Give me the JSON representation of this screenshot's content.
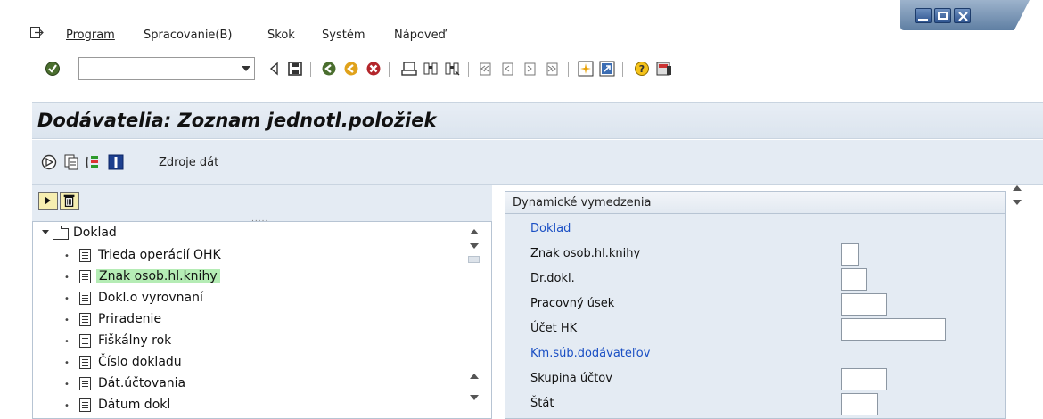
{
  "menu": {
    "items": [
      {
        "label": "Program"
      },
      {
        "label": "Spracovanie(B)"
      },
      {
        "label": "Skok"
      },
      {
        "label": "Systém"
      },
      {
        "label": "Nápoveď"
      }
    ]
  },
  "toolbar": {
    "command_value": "",
    "icons": [
      "enter-check-icon",
      "back-arrow-icon",
      "save-icon",
      "back-icon",
      "exit-icon",
      "cancel-icon",
      "print-icon",
      "find-icon",
      "find-next-icon",
      "first-page-icon",
      "prev-page-icon",
      "next-page-icon",
      "last-page-icon",
      "new-session-icon",
      "shortcut-icon",
      "help-icon",
      "layout-icon"
    ]
  },
  "title": "Dodávatelia: Zoznam jednotl.položiek",
  "app_toolbar": {
    "source_label": "Zdroje dát"
  },
  "tree": {
    "root": "Doklad",
    "items": [
      {
        "label": "Trieda operácií OHK",
        "selected": false
      },
      {
        "label": "Znak osob.hl.knihy",
        "selected": true
      },
      {
        "label": "Dokl.o vyrovnaní",
        "selected": false
      },
      {
        "label": "Priradenie",
        "selected": false
      },
      {
        "label": "Fiškálny rok",
        "selected": false
      },
      {
        "label": "Číslo dokladu",
        "selected": false
      },
      {
        "label": "Dát.účtovania",
        "selected": false
      },
      {
        "label": "Dátum dokl",
        "selected": false
      }
    ]
  },
  "selections": {
    "header": "Dynamické vymedzenia",
    "rows": [
      {
        "label": "Doklad",
        "group": true
      },
      {
        "label": "Znak osob.hl.knihy",
        "group": false,
        "value": ""
      },
      {
        "label": "Dr.dokl.",
        "group": false,
        "value": ""
      },
      {
        "label": "Pracovný úsek",
        "group": false,
        "value": ""
      },
      {
        "label": "Účet HK",
        "group": false,
        "value": ""
      },
      {
        "label": "Km.súb.dodávateľov",
        "group": true
      },
      {
        "label": "Skupina účtov",
        "group": false,
        "value": ""
      },
      {
        "label": "Štát",
        "group": false,
        "value": ""
      }
    ]
  }
}
